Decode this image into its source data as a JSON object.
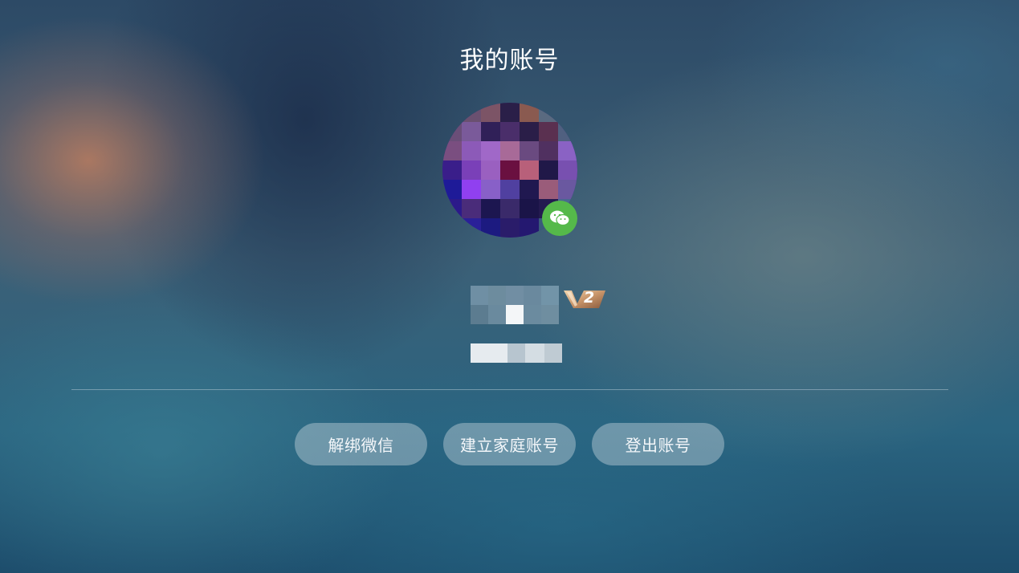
{
  "page": {
    "title": "我的账号"
  },
  "profile": {
    "avatar_icon": "user-avatar-pixelated",
    "login_method_icon": "wechat-icon",
    "login_method_color": "#55b94a",
    "vip_badge_text": "2",
    "vip_badge_icon": "vip-level-badge"
  },
  "actions": {
    "unbind_wechat": "解绑微信",
    "create_family_account": "建立家庭账号",
    "logout": "登出账号"
  },
  "colors": {
    "button_bg": "rgba(220,228,235,0.38)",
    "text": "#ffffff",
    "vip_gold": "#c8956a"
  }
}
